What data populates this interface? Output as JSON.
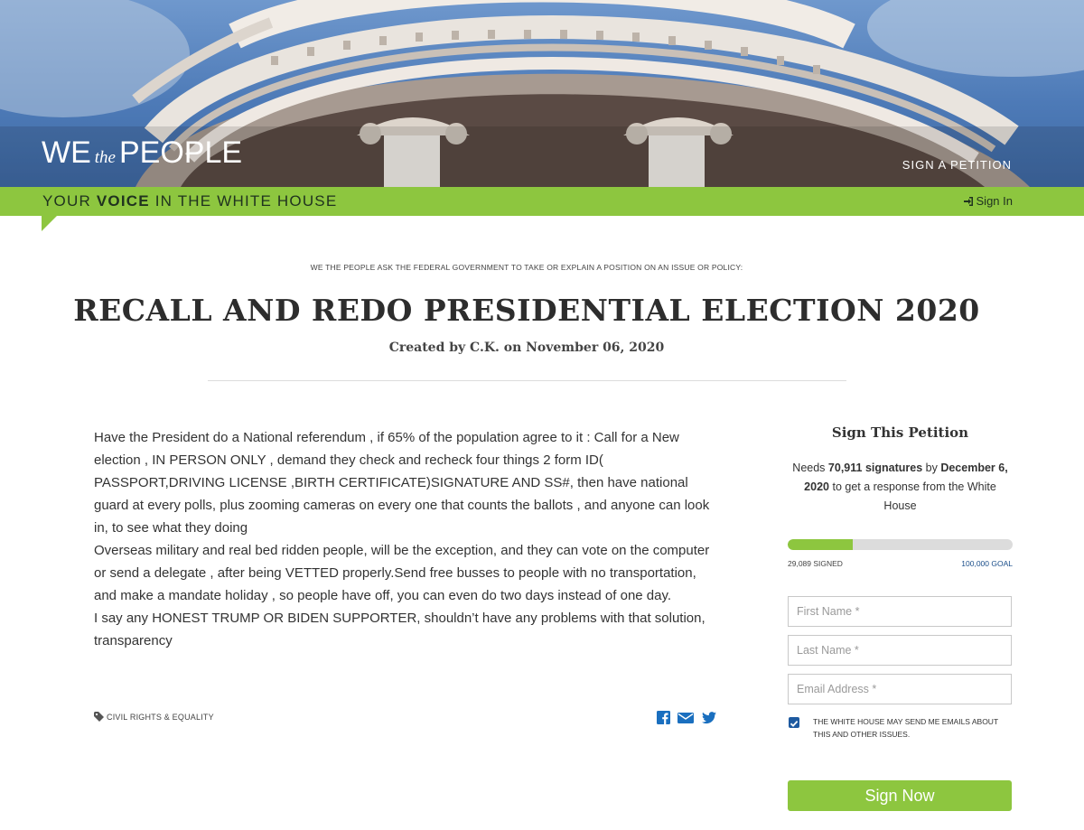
{
  "header": {
    "logo": {
      "we": "WE",
      "the": "the",
      "people": "PEOPLE"
    },
    "nav_sign_petition": "SIGN A PETITION",
    "tagline_pre": "YOUR",
    "tagline_bold": "VOICE",
    "tagline_post": "IN THE WHITE HOUSE",
    "sign_in": "Sign In"
  },
  "petition": {
    "kicker": "WE THE PEOPLE ASK THE FEDERAL GOVERNMENT TO TAKE OR EXPLAIN A POSITION ON AN ISSUE OR POLICY:",
    "title": "RECALL AND REDO PRESIDENTIAL ELECTION 2020",
    "created": "Created by C.K. on November 06, 2020",
    "paragraphs": [
      "Have the President do a National referendum , if 65% of the population agree to it : Call for a New election , IN PERSON ONLY , demand they check and recheck four things 2 form ID( PASSPORT,DRIVING LICENSE ,BIRTH CERTIFICATE)SIGNATURE AND SS#, then have national guard at every polls, plus zooming cameras on every one that counts the ballots , and anyone can look in, to see what they doing",
      "Overseas military and real bed ridden people, will be the exception, and they can vote on the computer or send a delegate , after being VETTED properly.Send free busses to people with no transportation, and make a mandate holiday , so people have off, you can even do two days instead of one day.",
      "I say any HONEST TRUMP OR BIDEN SUPPORTER, shouldn’t have any problems with that solution, transparency"
    ],
    "issue_tag": "CIVIL RIGHTS & EQUALITY",
    "share_icons": [
      "facebook-icon",
      "email-icon",
      "twitter-icon"
    ]
  },
  "sidebar": {
    "heading": "Sign This Petition",
    "needs_pre": "Needs",
    "needs_count": "70,911 signatures",
    "needs_by": "by",
    "needs_date": "December 6, 2020",
    "needs_post": "to get a response from the White House",
    "signed_label": "29,089 SIGNED",
    "goal_label": "100,000 GOAL",
    "progress_fraction": 0.29089,
    "first_name_placeholder": "First Name *",
    "last_name_placeholder": "Last Name *",
    "email_placeholder": "Email Address *",
    "optin_checked": true,
    "optin_text": "THE WHITE HOUSE MAY SEND ME EMAILS ABOUT THIS AND OTHER ISSUES.",
    "submit_label": "Sign Now"
  },
  "colors": {
    "brand_green": "#8dc63f",
    "link_blue": "#1a4e8a",
    "checkbox_blue": "#1e5aa0"
  }
}
